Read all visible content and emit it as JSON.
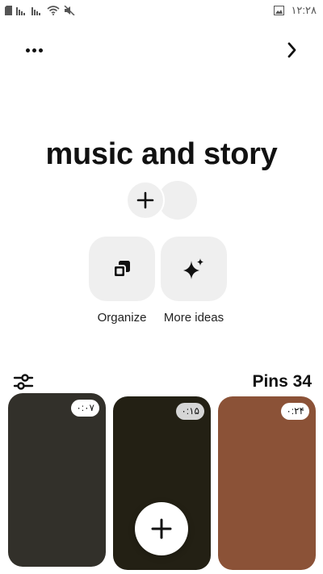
{
  "status_bar": {
    "time": "۱۲:۲۸",
    "icons": [
      "sim-card-icon",
      "signal-icon",
      "signal-icon",
      "wifi-icon",
      "mute-icon",
      "gallery-icon"
    ]
  },
  "header": {
    "more_icon": "more-horizontal-icon",
    "next_icon": "chevron-right-icon"
  },
  "board": {
    "title": "music and story"
  },
  "actions": [
    {
      "label": "Organize",
      "icon": "organize-icon"
    },
    {
      "label": "More ideas",
      "icon": "sparkle-icon"
    }
  ],
  "pins": {
    "count_label": "Pins 34",
    "filter_icon": "filter-icon",
    "items": [
      {
        "duration": "۰:۰۷",
        "color": "#32302a"
      },
      {
        "duration": "۰:۱۵",
        "color": "#232014"
      },
      {
        "duration": "۰:۲۴",
        "color": "#8b5237"
      }
    ]
  },
  "fab_icon": "plus-icon"
}
